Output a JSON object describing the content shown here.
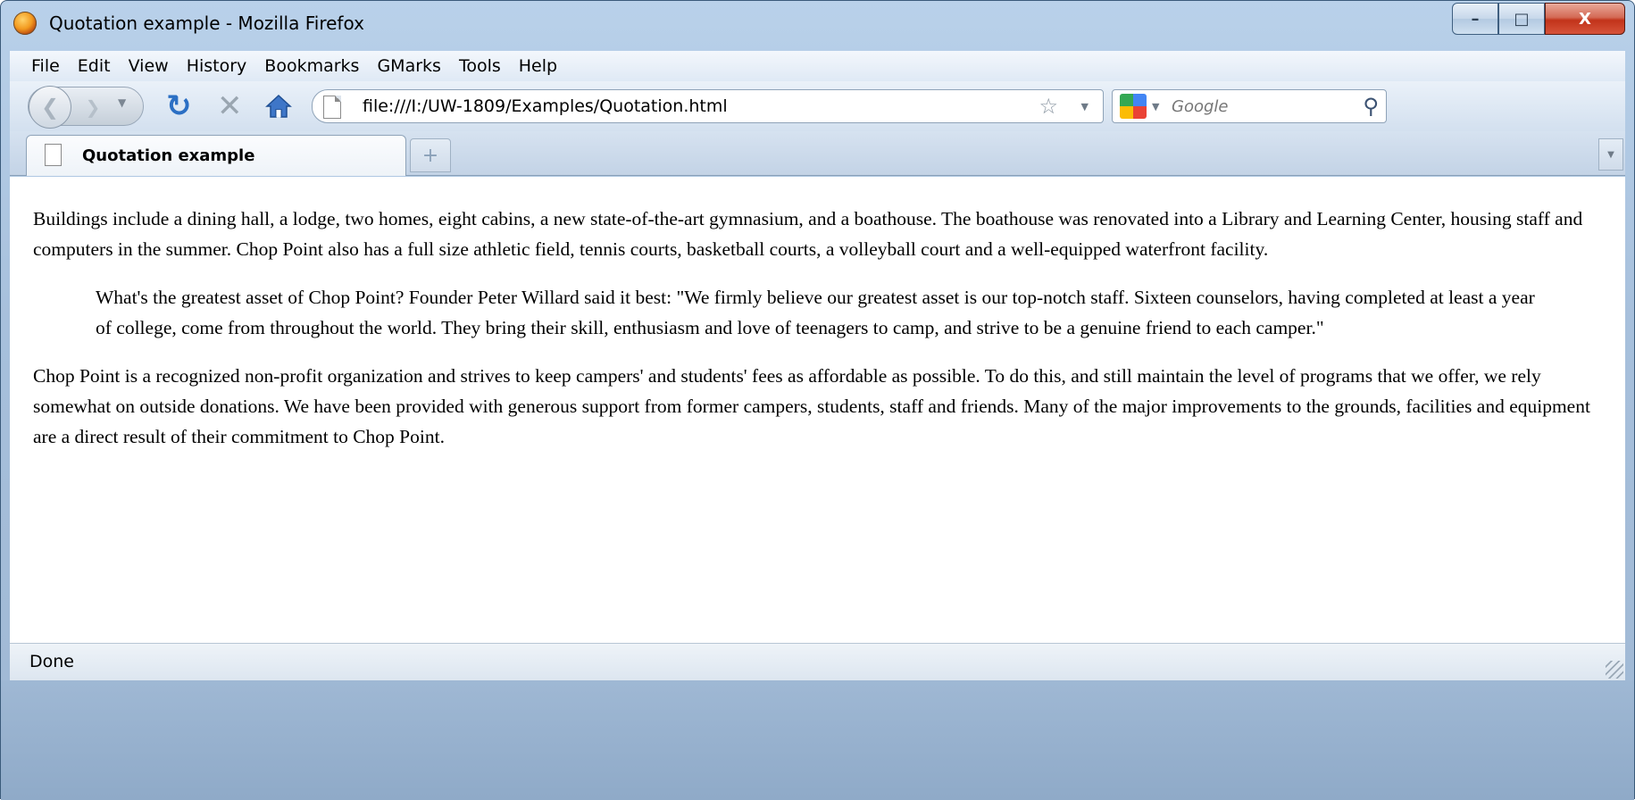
{
  "window": {
    "title": "Quotation example - Mozilla Firefox",
    "controls": {
      "minimize": "–",
      "maximize": "□",
      "close": "X"
    }
  },
  "menu": [
    "File",
    "Edit",
    "View",
    "History",
    "Bookmarks",
    "GMarks",
    "Tools",
    "Help"
  ],
  "nav": {
    "url": "file:///I:/UW-1809/Examples/Quotation.html",
    "search_placeholder": "Google",
    "icons": [
      "back-icon",
      "forward-icon",
      "reload-icon",
      "stop-icon",
      "home-icon",
      "page-icon",
      "bookmark-star-icon",
      "google-icon",
      "search-icon"
    ]
  },
  "tabs": {
    "active_label": "Quotation example",
    "new_tab": "+"
  },
  "content": {
    "para1": "Buildings include a dining hall, a lodge, two homes, eight cabins, a new state-of-the-art gymnasium, and a boathouse. The boathouse was renovated into a Library and Learning Center, housing staff and computers in the summer. Chop Point also has a full size athletic field, tennis courts, basketball courts, a volleyball court and a well-equipped waterfront facility.",
    "quote": "What's the greatest asset of Chop Point? Founder Peter Willard said it best: \"We firmly believe our greatest asset is our top-notch staff. Sixteen counselors, having completed at least a year of college, come from throughout the world. They bring their skill, enthusiasm and love of teenagers to camp, and strive to be a genuine friend to each camper.\"",
    "para2": "Chop Point is a recognized non-profit organization and strives to keep campers' and students' fees as affordable as possible. To do this, and still maintain the level of programs that we offer, we rely somewhat on outside donations. We have been provided with generous support from former campers, students, staff and friends. Many of the major improvements to the grounds, facilities and equipment are a direct result of their commitment to Chop Point."
  },
  "status": "Done"
}
